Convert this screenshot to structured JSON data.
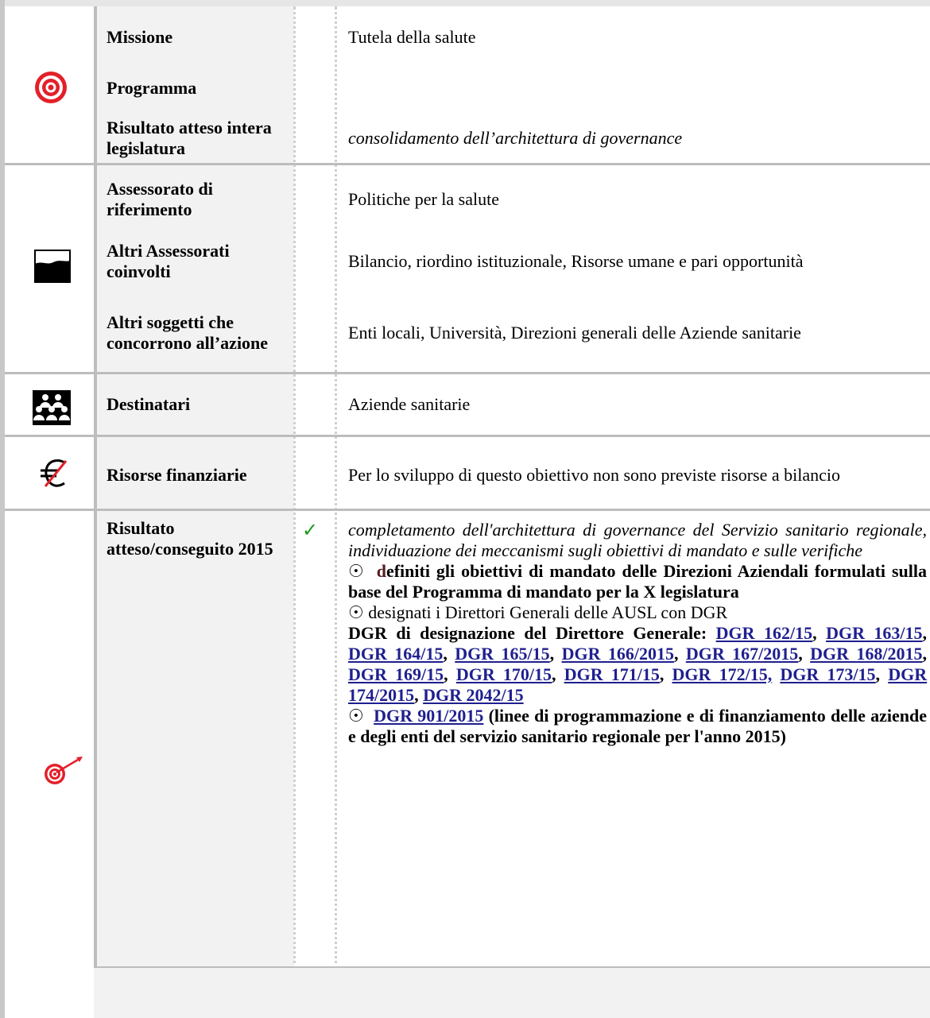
{
  "rows": {
    "missione": {
      "label": "Missione",
      "value": "Tutela della salute"
    },
    "programma": {
      "label": "Programma",
      "value": ""
    },
    "risultato_legislatura": {
      "label": "Risultato atteso intera legislatura",
      "value": "consolidamento dell’architettura di governance"
    },
    "assessorato": {
      "label": "Assessorato di riferimento",
      "value": "Politiche per la salute"
    },
    "altri_assessorati": {
      "label": "Altri Assessorati coinvolti",
      "value": "Bilancio, riordino istituzionale, Risorse umane e pari opportunità"
    },
    "altri_soggetti": {
      "label": "Altri soggetti che concorrono all’azione",
      "value": "Enti locali, Università, Direzioni generali delle Aziende sanitarie"
    },
    "destinatari": {
      "label": "Destinatari",
      "value": "Aziende sanitarie"
    },
    "risorse": {
      "label": "Risorse finanziarie",
      "value": "Per lo sviluppo di questo obiettivo non sono previste risorse a bilancio"
    },
    "risultato_2015": {
      "label": "Risultato atteso/conseguito 2015",
      "check": "✓",
      "intro": "completamento dell'architettura di governance del Servizio sanitario regionale, individuazione dei meccanismi sugli obiettivi di mandato e sulle verifiche",
      "bullet_symbol": "☉",
      "bullet1_d": "d",
      "bullet1_rest": "efiniti gli obiettivi di mandato delle Direzioni Aziendali formulati sulla base del Programma di mandato per la X legislatura",
      "bullet2": "designati i Direttori Generali delle AUSL con DGR",
      "dgr_intro": "DGR di designazione del Direttore Generale:",
      "dgr_links": [
        "DGR 162/15",
        "DGR 163/15",
        "DGR 164/15",
        "DGR 165/15",
        "DGR 166/2015",
        "DGR 167/2015",
        "DGR 168/2015",
        "DGR 169/15",
        "DGR 170/15",
        "DGR 171/15",
        "DGR 172/15,",
        "DGR 173/15",
        "DGR 174/2015",
        "DGR 2042/15"
      ],
      "bullet3_link": "DGR 901/2015",
      "bullet3_rest": "(linee di programmazione e di finanziamento delle aziende e degli enti del servizio sanitario regionale per l'anno 2015)"
    }
  },
  "icons": {
    "target": "target-icon",
    "assessorato": "landscape-icon",
    "destinatari": "group-icon",
    "risorse": "no-euro-icon",
    "risultato": "dart-target-icon"
  },
  "colors": {
    "accent_red": "#e3202a",
    "link": "#1f1f8f",
    "check": "#1a9a1a"
  }
}
